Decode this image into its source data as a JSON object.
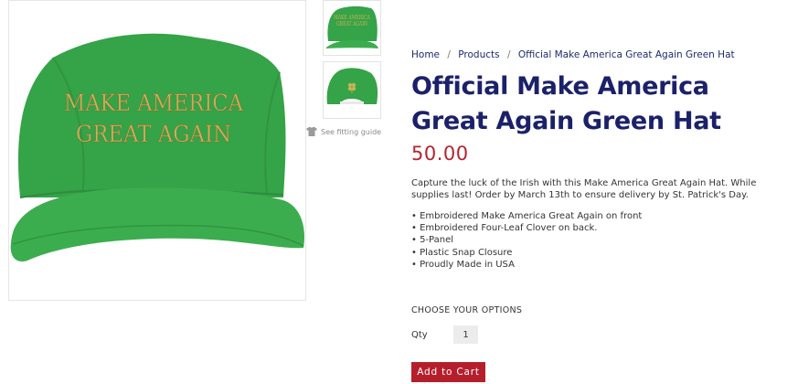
{
  "gallery": {
    "main_hat_text": [
      "MAKE AMERICA",
      "GREAT AGAIN"
    ],
    "thumb_front_text": [
      "MAKE AMERICA",
      "GREAT AGAIN"
    ],
    "fitting_guide_label": "See fitting guide",
    "hat_color": "#38a64a",
    "embroidery_color": "#c9b15a"
  },
  "breadcrumb": {
    "items": [
      "Home",
      "Products"
    ],
    "current": "Official Make America Great Again Green Hat",
    "separator": "/"
  },
  "product": {
    "title": "Official Make America Great Again Green Hat",
    "price": "50.00",
    "description": "Capture the luck of the Irish with this Make America Great Again Hat.  While supplies last!  Order by March 13th to ensure delivery by St. Patrick's Day.",
    "features": [
      "Embroidered Make America Great Again on front",
      "Embroidered Four-Leaf Clover on back.",
      "5-Panel",
      "Plastic Snap Closure",
      "Proudly Made in USA"
    ]
  },
  "options": {
    "heading": "CHOOSE YOUR OPTIONS",
    "qty_label": "Qty",
    "qty_value": "1"
  },
  "cart": {
    "button_label": "Add to Cart"
  },
  "colors": {
    "title": "#1b2169",
    "price": "#b5242f",
    "button": "#b51f2c"
  }
}
